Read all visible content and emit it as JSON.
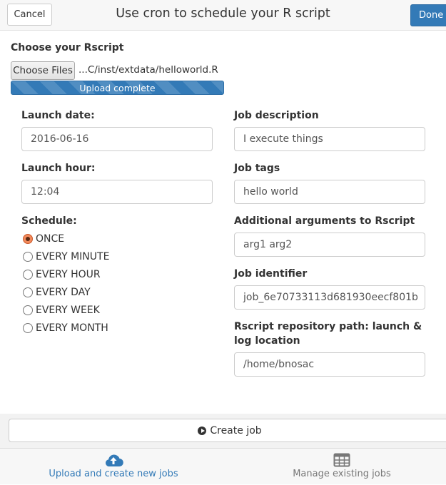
{
  "header": {
    "cancel_label": "Cancel",
    "title": "Use cron to schedule your R script",
    "done_label": "Done"
  },
  "upload": {
    "label": "Choose your Rscript",
    "choose_button": "Choose Files",
    "file_name": "...C/inst/extdata/helloworld.R",
    "progress_text": "Upload complete",
    "progress": 1.0
  },
  "left": {
    "launch_date_label": "Launch date:",
    "launch_date_value": "2016-06-16",
    "launch_hour_label": "Launch hour:",
    "launch_hour_value": "12:04",
    "schedule_label": "Schedule:",
    "schedule_options": [
      {
        "label": "ONCE",
        "checked": true
      },
      {
        "label": "EVERY MINUTE",
        "checked": false
      },
      {
        "label": "EVERY HOUR",
        "checked": false
      },
      {
        "label": "EVERY DAY",
        "checked": false
      },
      {
        "label": "EVERY WEEK",
        "checked": false
      },
      {
        "label": "EVERY MONTH",
        "checked": false
      }
    ]
  },
  "right": {
    "job_description_label": "Job description",
    "job_description_value": "I execute things",
    "job_tags_label": "Job tags",
    "job_tags_value": "hello world",
    "additional_args_label": "Additional arguments to Rscript",
    "additional_args_value": "arg1 arg2",
    "job_identifier_label": "Job identifier",
    "job_identifier_value": "job_6e70733113d681930eecf801b",
    "repo_path_label": "Rscript repository path: launch & log location",
    "repo_path_value": "/home/bnosac"
  },
  "actions": {
    "create_label": "Create job"
  },
  "tabs": [
    {
      "label": "Upload and create new jobs",
      "icon": "cloud-upload-icon",
      "active": true
    },
    {
      "label": "Manage existing jobs",
      "icon": "table-icon",
      "active": false
    }
  ],
  "colors": {
    "primary": "#337ab7",
    "radio_checked": "#f28a5c"
  }
}
